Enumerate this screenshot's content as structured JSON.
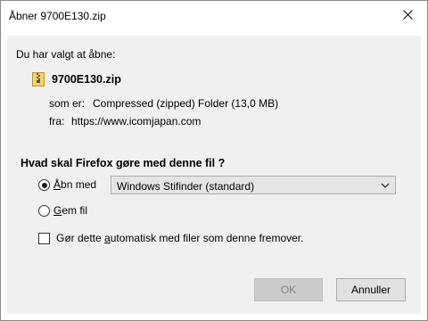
{
  "window": {
    "title": "Åbner 9700E130.zip"
  },
  "intro": "Du har valgt at åbne:",
  "file": {
    "name": "9700E130.zip",
    "type_label": "som er:",
    "type_value": "Compressed (zipped) Folder (13,0 MB)",
    "from_label": "fra:",
    "from_value": "https://www.icomjapan.com",
    "icon": "zip-file-icon"
  },
  "question": "Hvad skal Firefox gøre med denne fil ?",
  "options": {
    "open_with": {
      "label_pre": "",
      "label_mnemonic": "Å",
      "label_post": "bn med",
      "selected": true
    },
    "open_with_app": "Windows Stifinder (standard)",
    "save_file": {
      "label_pre": "",
      "label_mnemonic": "G",
      "label_post": "em fil",
      "selected": false
    },
    "auto": {
      "label_pre": "Gør dette ",
      "label_mnemonic": "a",
      "label_post": "utomatisk med filer som denne fremover.",
      "checked": false
    }
  },
  "buttons": {
    "ok": "OK",
    "cancel": "Annuller"
  },
  "colors": {
    "client_bg": "#f0f0f0",
    "button_bg": "#e1e1e1",
    "disabled_button_bg": "#cccccc"
  }
}
